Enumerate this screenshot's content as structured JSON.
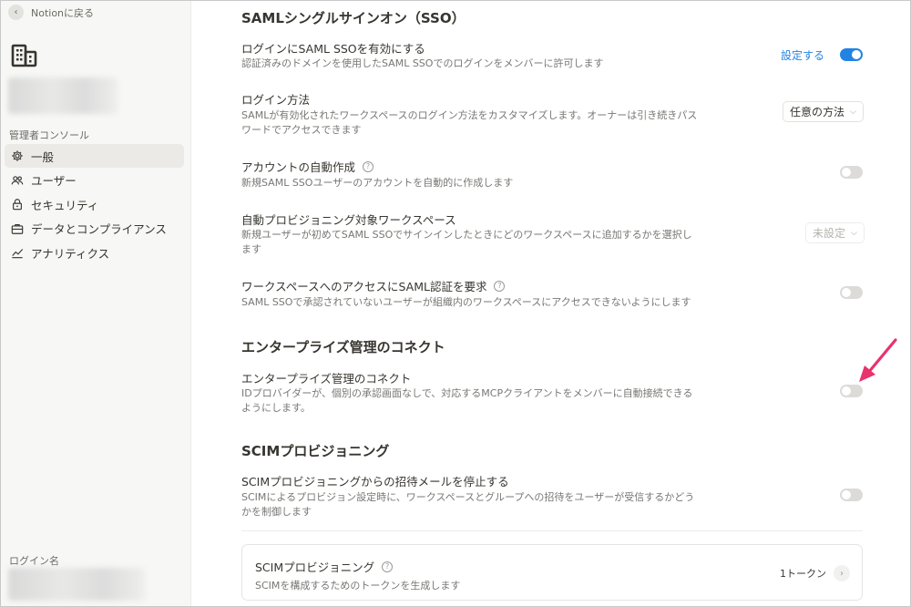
{
  "sidebar": {
    "back_label": "Notionに戻る",
    "admin_console_label": "管理者コンソール",
    "login_name_label": "ログイン名",
    "items": [
      {
        "label": "一般",
        "icon": "gear-icon",
        "active": true
      },
      {
        "label": "ユーザー",
        "icon": "users-icon",
        "active": false
      },
      {
        "label": "セキュリティ",
        "icon": "lock-icon",
        "active": false
      },
      {
        "label": "データとコンプライアンス",
        "icon": "briefcase-icon",
        "active": false
      },
      {
        "label": "アナリティクス",
        "icon": "chart-icon",
        "active": false
      }
    ]
  },
  "main": {
    "saml_section_title": "SAMLシングルサインオン（SSO）",
    "saml_enable": {
      "title": "ログインにSAML SSOを有効にする",
      "desc": "認証済みのドメインを使用したSAML SSOでのログインをメンバーに許可します",
      "link": "設定する",
      "toggle": "on"
    },
    "login_method": {
      "title": "ログイン方法",
      "desc": "SAMLが有効化されたワークスペースのログイン方法をカスタマイズします。オーナーは引き続きパスワードでアクセスできます",
      "value": "任意の方法"
    },
    "auto_account": {
      "title": "アカウントの自動作成",
      "desc": "新規SAML SSOユーザーのアカウントを自動的に作成します",
      "toggle": "off"
    },
    "auto_provision": {
      "title": "自動プロビジョニング対象ワークスペース",
      "desc": "新規ユーザーが初めてSAML SSOでサインインしたときにどのワークスペースに追加するかを選択します",
      "value": "未設定"
    },
    "require_saml": {
      "title": "ワークスペースへのアクセスにSAML認証を要求",
      "desc": "SAML SSOで承認されていないユーザーが組織内のワークスペースにアクセスできないようにします",
      "toggle": "off"
    },
    "enterprise_section_title": "エンタープライズ管理のコネクト",
    "enterprise_connect": {
      "title": "エンタープライズ管理のコネクト",
      "desc": "IDプロバイダーが、個別の承認画面なしで、対応するMCPクライアントをメンバーに自動接続できるようにします。",
      "toggle": "off"
    },
    "scim_section_title": "SCIMプロビジョニング",
    "scim_stop_email": {
      "title": "SCIMプロビジョニングからの招待メールを停止する",
      "desc": "SCIMによるプロビジョン設定時に、ワークスペースとグループへの招待をユーザーが受信するかどうかを制御します",
      "toggle": "off"
    },
    "scim_card": {
      "title": "SCIMプロビジョニング",
      "desc": "SCIMを構成するためのトークンを生成します",
      "count": "1トークン"
    }
  },
  "colors": {
    "accent": "#2383e2",
    "annotation_arrow": "#e8336d"
  }
}
